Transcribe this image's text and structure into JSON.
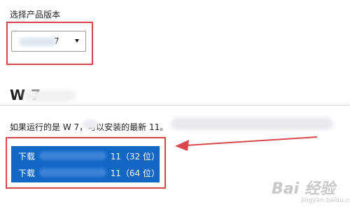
{
  "select_section": {
    "label": "选择产品版本",
    "selected_value": "7"
  },
  "version_section": {
    "heading": "W        7",
    "body_text": "如果运行的是 W         7，可以安装的最新                                                          11。"
  },
  "downloads": [
    {
      "prefix": "下载",
      "suffix": "11（32 位）"
    },
    {
      "prefix": "下载",
      "suffix": "11（64 位）"
    }
  ],
  "annotations": {
    "highlight_color": "#d9474b",
    "button_color": "#1266c4"
  },
  "watermark": {
    "logo_text": "Bai 经验",
    "sub_text": "jingyan.baidu.com"
  }
}
